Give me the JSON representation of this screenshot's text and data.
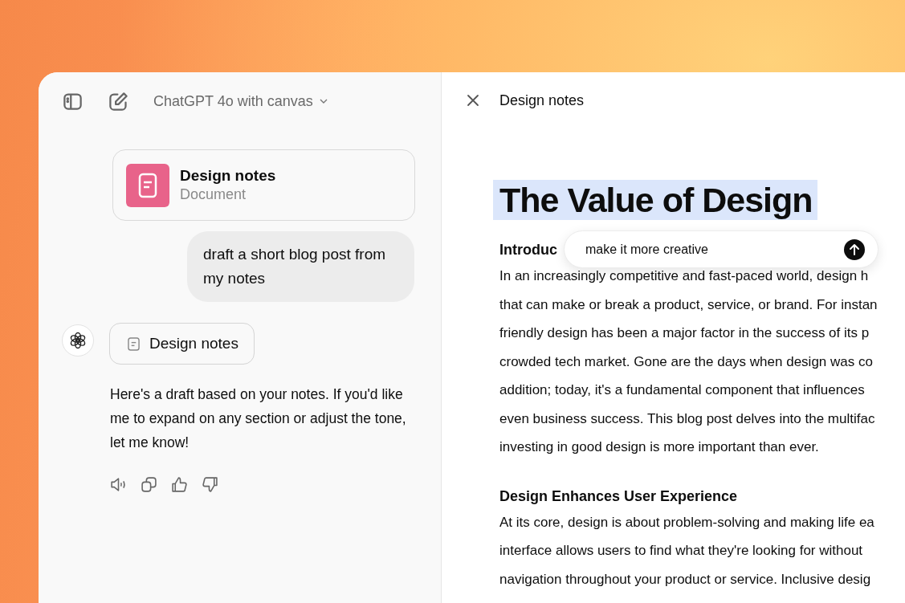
{
  "header": {
    "model_selector": "ChatGPT 4o with canvas"
  },
  "chat": {
    "document_card": {
      "title": "Design notes",
      "subtitle": "Document"
    },
    "user_message": "draft a short blog post from my notes",
    "assistant": {
      "document_chip": "Design notes",
      "message": "Here's a draft based on your notes. If you'd like me to expand on any section or adjust the tone, let me know!",
      "actions": [
        {
          "kind": "read_aloud"
        },
        {
          "kind": "copy"
        },
        {
          "kind": "like"
        },
        {
          "kind": "dislike"
        }
      ]
    }
  },
  "canvas": {
    "title": "Design notes",
    "heading": {
      "text": "The Value of Design",
      "selected": true
    },
    "edit_prompt": {
      "value": "make it more creative"
    },
    "sections": [
      {
        "heading": "Introduc",
        "lines": [
          "In an increasingly competitive and fast-paced world, design h",
          "that can make or break a product, service, or brand. For instan",
          "friendly design has been a major factor in the success of its p",
          "crowded tech market. Gone are the days when design was co",
          "addition; today, it's a fundamental component that influences",
          "even business success. This blog post delves into the multifac",
          "investing in good design is more important than ever."
        ]
      },
      {
        "heading": "Design Enhances User Experience",
        "lines": [
          "At its core, design is about problem-solving and making life ea",
          "interface allows users to find what they're looking for without",
          "navigation throughout your product or service. Inclusive desig"
        ]
      }
    ]
  }
}
